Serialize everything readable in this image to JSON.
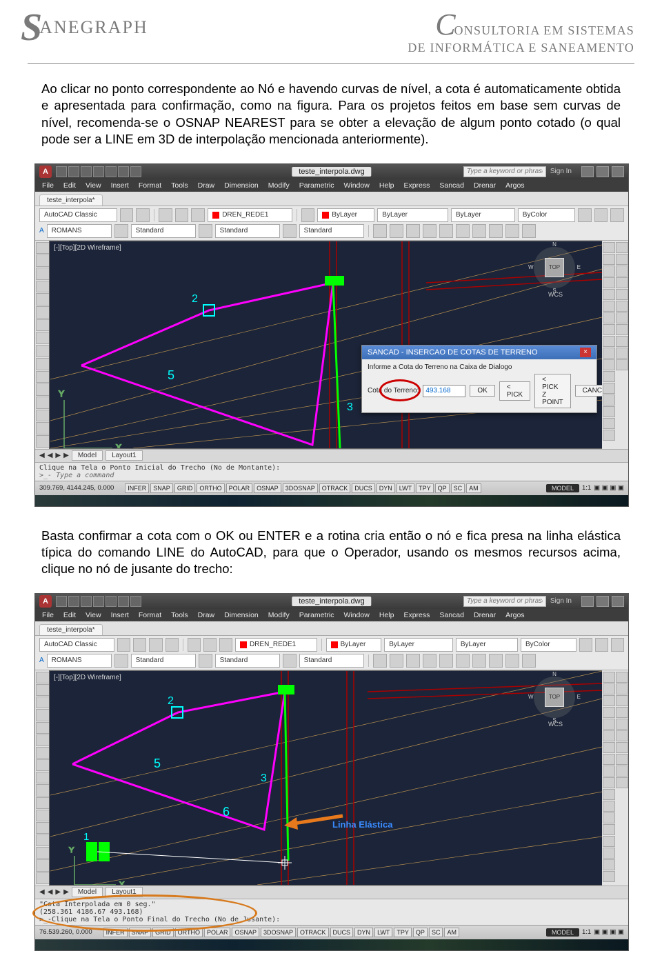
{
  "header": {
    "logo_s": "S",
    "logo_rest": "ANEGRAPH",
    "right_c": "C",
    "right_line1": "ONSULTORIA EM SISTEMAS",
    "right_line2": "DE INFORMÁTICA E SANEAMENTO"
  },
  "para1": "Ao clicar no ponto correspondente ao Nó e havendo curvas de nível, a cota é automaticamente obtida e apresentada para confirmação, como na figura. Para os projetos feitos em base sem curvas de nível, recomenda-se o OSNAP NEAREST para se obter a elevação de algum ponto cotado (o qual pode ser a LINE em 3D de interpolação mencionada anteriormente).",
  "para2": "Basta confirmar a cota com o OK ou ENTER e a rotina cria então o nó e fica presa na linha elástica típica do comando LINE do AutoCAD, para que o Operador, usando os mesmos recursos acima, clique no nó de jusante do trecho:",
  "cad1": {
    "title": "teste_interpola.dwg",
    "search_placeholder": "Type a keyword or phrase",
    "sign_in": "Sign In",
    "menus": [
      "File",
      "Edit",
      "View",
      "Insert",
      "Format",
      "Tools",
      "Draw",
      "Dimension",
      "Modify",
      "Parametric",
      "Window",
      "Help",
      "Express",
      "Sancad",
      "Drenar",
      "Argos"
    ],
    "tab": "teste_interpola*",
    "workspace": "AutoCAD Classic",
    "layer": "DREN_REDE1",
    "bylayer": "ByLayer",
    "bycolor": "ByColor",
    "textstyle": "ROMANS",
    "std": "Standard",
    "viewport_label": "[-][Top][2D Wireframe]",
    "viewcube_face": "TOP",
    "wcs": "WCS",
    "node_labels": [
      "2",
      "5",
      "3"
    ],
    "axis_y": "Y",
    "axis_x": "X",
    "dialog": {
      "title": "SANCAD - INSERCAO DE COTAS DE TERRENO",
      "hint": "Informe a Cota do Terreno na Caixa de Dialogo",
      "field_label": "Cota do Terreno:",
      "value": "493.168",
      "ok": "OK",
      "pick": "< PICK",
      "pickz": "< PICK Z POINT",
      "cancel": "CANCELA"
    },
    "model_tabs": [
      "Model",
      "Layout1"
    ],
    "cmd_line1": "Clique na Tela o Ponto Inicial do Trecho (No de Montante):",
    "cmd_prompt": ">_- Type a command",
    "coords": "309.769, 4144.245, 0.000",
    "toggles": [
      "INFER",
      "SNAP",
      "GRID",
      "ORTHO",
      "POLAR",
      "OSNAP",
      "3DOSNAP",
      "OTRACK",
      "DUCS",
      "DYN",
      "LWT",
      "TPY",
      "QP",
      "SC",
      "AM"
    ],
    "status_model": "MODEL",
    "status_scale": "1:1"
  },
  "cad2": {
    "title": "teste_interpola.dwg",
    "search_placeholder": "Type a keyword or phrase",
    "sign_in": "Sign In",
    "menus": [
      "File",
      "Edit",
      "View",
      "Insert",
      "Format",
      "Tools",
      "Draw",
      "Dimension",
      "Modify",
      "Parametric",
      "Window",
      "Help",
      "Express",
      "Sancad",
      "Drenar",
      "Argos"
    ],
    "tab": "teste_interpola*",
    "workspace": "AutoCAD Classic",
    "layer": "DREN_REDE1",
    "bylayer": "ByLayer",
    "bycolor": "ByColor",
    "textstyle": "ROMANS",
    "std": "Standard",
    "viewport_label": "[-][Top][2D Wireframe]",
    "viewcube_face": "TOP",
    "wcs": "WCS",
    "node_labels": [
      "2",
      "5",
      "3",
      "1",
      "6"
    ],
    "elastic_label": "Linha Elástica",
    "model_tabs": [
      "Model",
      "Layout1"
    ],
    "cmd_line1": "\"Cota Interpolada em 0 seg.\"",
    "cmd_line2": "(258.361 4186.67 493.168)",
    "cmd_line3": ">_-Clique na Tela o Ponto Final do Trecho (No de Jusante):",
    "coords": "76.539.260, 0.000",
    "toggles": [
      "INFER",
      "SNAP",
      "GRID",
      "ORTHO",
      "POLAR",
      "OSNAP",
      "3DOSNAP",
      "OTRACK",
      "DUCS",
      "DYN",
      "LWT",
      "TPY",
      "QP",
      "SC",
      "AM"
    ],
    "status_model": "MODEL",
    "status_scale": "1:1"
  }
}
